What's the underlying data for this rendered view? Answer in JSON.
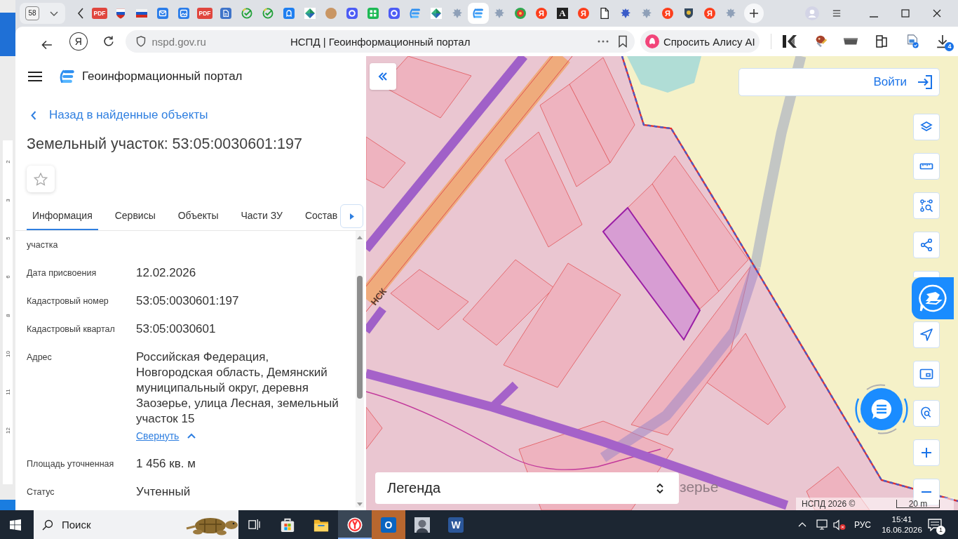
{
  "browser": {
    "tab_count": "58",
    "tabs": [
      {
        "kind": "pdf",
        "glyph": "PDF",
        "selected": false
      },
      {
        "kind": "shield_flag",
        "selected": false
      },
      {
        "kind": "flag",
        "selected": false
      },
      {
        "kind": "mail",
        "selected": false
      },
      {
        "kind": "image",
        "selected": false
      },
      {
        "kind": "pdf",
        "glyph": "PDF",
        "selected": false
      },
      {
        "kind": "doc_blue",
        "selected": false
      },
      {
        "kind": "check",
        "selected": false
      },
      {
        "kind": "check",
        "selected": false
      },
      {
        "kind": "chat",
        "selected": false
      },
      {
        "kind": "diamond",
        "selected": false
      },
      {
        "kind": "avatar",
        "selected": false
      },
      {
        "kind": "ring",
        "selected": false
      },
      {
        "kind": "grid",
        "selected": false
      },
      {
        "kind": "ring",
        "selected": false
      },
      {
        "kind": "stack",
        "selected": false
      },
      {
        "kind": "diamond",
        "selected": false
      },
      {
        "kind": "emblem",
        "selected": false
      },
      {
        "kind": "stack",
        "selected": true
      },
      {
        "kind": "emblem",
        "selected": false
      },
      {
        "kind": "round_emblem",
        "selected": false
      },
      {
        "kind": "letter_circle",
        "glyph": "Я",
        "selected": false
      },
      {
        "kind": "letter_square",
        "glyph": "A",
        "selected": false
      },
      {
        "kind": "letter_circle",
        "glyph": "Я",
        "selected": false
      },
      {
        "kind": "doc",
        "selected": false
      },
      {
        "kind": "emblem_blue",
        "selected": false
      },
      {
        "kind": "emblem",
        "selected": false
      },
      {
        "kind": "letter_circle",
        "glyph": "Я",
        "selected": false
      },
      {
        "kind": "crest",
        "selected": false
      },
      {
        "kind": "letter_circle",
        "glyph": "Я",
        "selected": false
      },
      {
        "kind": "emblem",
        "selected": false
      }
    ],
    "home_glyph": "Я",
    "url": "nspd.gov.ru",
    "page_title": "НСПД | Геоинформационный портал",
    "assistant_button": "Спросить Алису AI",
    "downloads_count": "4"
  },
  "background_window": {
    "ruler_marks": [
      "2",
      "3",
      "5",
      "6",
      "8",
      "10",
      "11",
      "12"
    ]
  },
  "panel": {
    "portal_name": "Геоинформационный портал",
    "back_link": "Назад в найденные объекты",
    "title": "Земельный участок: 53:05:0030601:197",
    "favorite": false,
    "tabs": [
      {
        "label": "Информация",
        "selected": true
      },
      {
        "label": "Сервисы",
        "selected": false
      },
      {
        "label": "Объекты",
        "selected": false
      },
      {
        "label": "Части ЗУ",
        "selected": false
      },
      {
        "label": "Состав",
        "selected": false
      }
    ],
    "fields": [
      {
        "label": "участка"
      },
      {
        "label": "Дата присвоения",
        "value": "12.02.2026"
      },
      {
        "label": "Кадастровый номер",
        "value": "53:05:0030601:197"
      },
      {
        "label": "Кадастровый квартал",
        "value": "53:05:0030601"
      },
      {
        "label": "Адрес",
        "value": "Российская Федерация, Новгородская область, Демянский муниципальный округ, деревня Заозерье, улица Лесная, земельный участок 15",
        "toggle": "Свернуть"
      },
      {
        "label": "Площадь уточненная",
        "value": "1 456 кв. м"
      },
      {
        "label": "Статус",
        "value": "Учтенный"
      }
    ]
  },
  "map": {
    "road_label": "НСК",
    "place_label": "зерье",
    "login_button": "Войти",
    "legend": "Легенда",
    "attribution": "НСПД 2026 ©",
    "scale": "20 m"
  },
  "taskbar": {
    "search_placeholder": "Поиск",
    "apps": [
      {
        "kind": "task_view",
        "selected": false,
        "flashing": false
      },
      {
        "kind": "store",
        "selected": false,
        "flashing": false
      },
      {
        "kind": "explorer",
        "selected": false,
        "flashing": false
      },
      {
        "kind": "browser",
        "selected": true,
        "flashing": false
      },
      {
        "kind": "mail_app",
        "glyph": "O",
        "selected": false,
        "flashing": true
      },
      {
        "kind": "avatar_app",
        "selected": false,
        "flashing": false
      },
      {
        "kind": "word",
        "glyph": "W",
        "selected": false,
        "flashing": false
      }
    ],
    "language": "РУС",
    "time": "15:41",
    "date": "16.06.2026",
    "notifications": "1"
  }
}
